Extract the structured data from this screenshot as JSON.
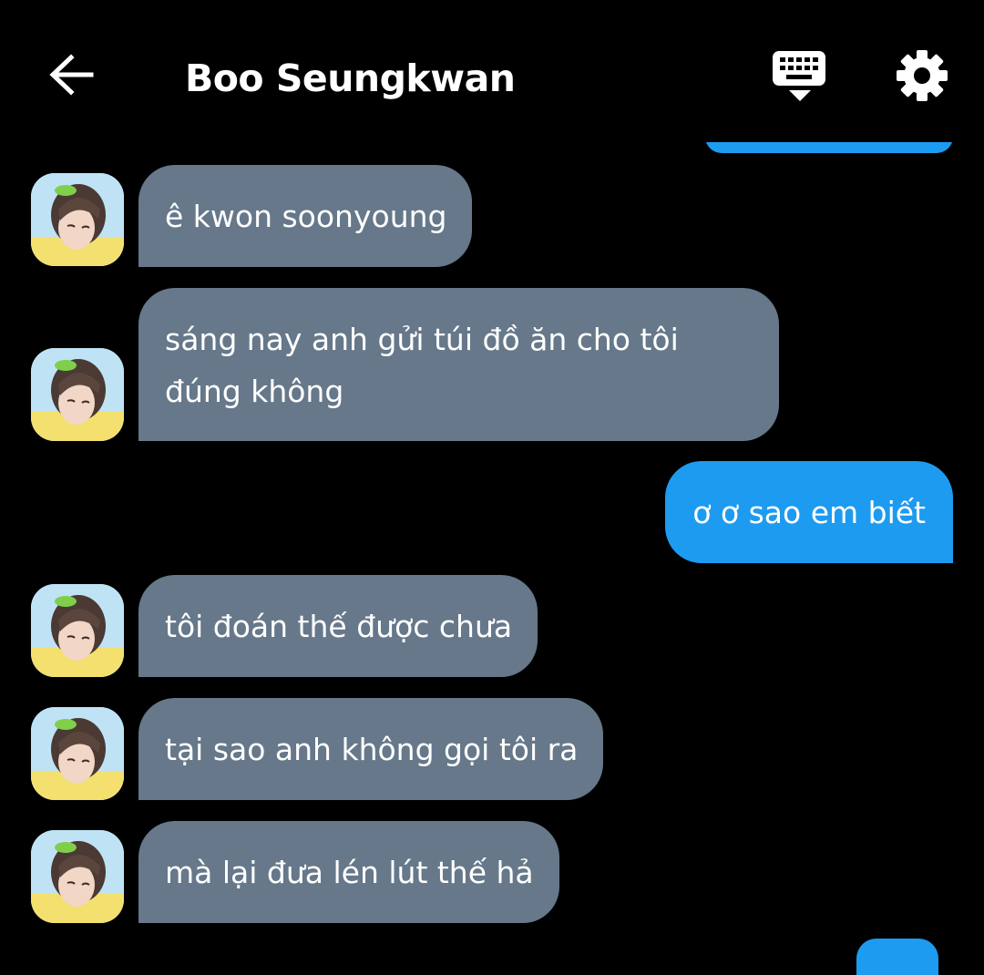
{
  "header": {
    "title": "Boo Seungkwan",
    "back_icon": "arrow-left-icon",
    "keyboard_icon": "keyboard-icon",
    "settings_icon": "gear-icon"
  },
  "colors": {
    "background": "#000000",
    "received_bubble": "#66788a",
    "sent_bubble": "#1d9bf0",
    "text": "#ffffff"
  },
  "messages": [
    {
      "sender": "received",
      "text": "ê kwon soonyoung"
    },
    {
      "sender": "received",
      "text": "sáng nay anh gửi túi đồ ăn cho tôi",
      "text2": "đúng không"
    },
    {
      "sender": "sent",
      "text": "ơ ơ sao em biết"
    },
    {
      "sender": "received",
      "text": "tôi đoán thế được chưa"
    },
    {
      "sender": "received",
      "text": "tại sao anh không gọi tôi ra"
    },
    {
      "sender": "received",
      "text": "mà lại đưa lén lút thế hả"
    }
  ]
}
